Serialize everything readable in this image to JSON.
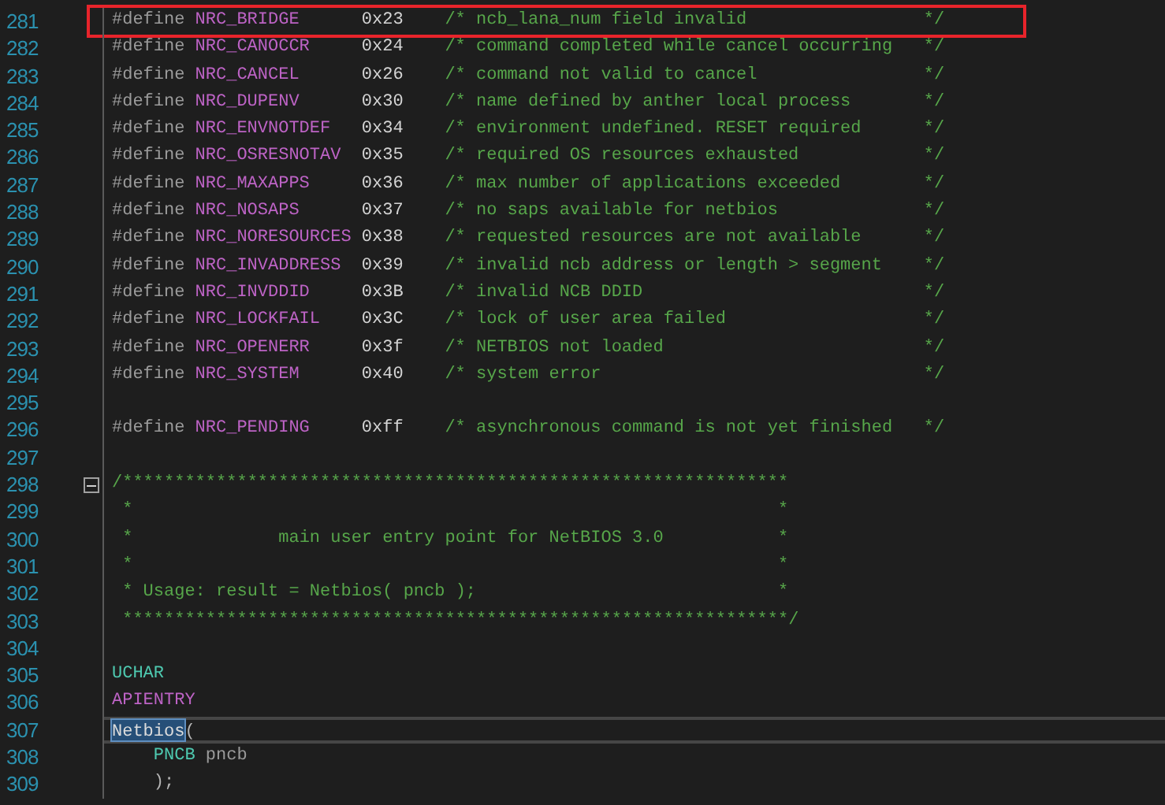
{
  "lines": [
    {
      "number": "281",
      "flagged": true,
      "tokens": [
        {
          "kind": "directive",
          "text": "#define"
        },
        {
          "kind": "macro",
          "text": "NRC_BRIDGE"
        },
        {
          "kind": "value",
          "text": "0x23"
        },
        {
          "kind": "comment",
          "text": "/* ncb_lana_num field invalid"
        },
        {
          "kind": "comment_end",
          "text": "*/"
        }
      ]
    },
    {
      "number": "282",
      "tokens": [
        {
          "kind": "directive",
          "text": "#define"
        },
        {
          "kind": "macro",
          "text": "NRC_CANOCCR"
        },
        {
          "kind": "value",
          "text": "0x24"
        },
        {
          "kind": "comment",
          "text": "/* command completed while cancel occurring"
        },
        {
          "kind": "comment_end",
          "text": "*/"
        }
      ]
    },
    {
      "number": "283",
      "tokens": [
        {
          "kind": "directive",
          "text": "#define"
        },
        {
          "kind": "macro",
          "text": "NRC_CANCEL"
        },
        {
          "kind": "value",
          "text": "0x26"
        },
        {
          "kind": "comment",
          "text": "/* command not valid to cancel"
        },
        {
          "kind": "comment_end",
          "text": "*/"
        }
      ]
    },
    {
      "number": "284",
      "tokens": [
        {
          "kind": "directive",
          "text": "#define"
        },
        {
          "kind": "macro",
          "text": "NRC_DUPENV"
        },
        {
          "kind": "value",
          "text": "0x30"
        },
        {
          "kind": "comment",
          "text": "/* name defined by anther local process"
        },
        {
          "kind": "comment_end",
          "text": "*/"
        }
      ]
    },
    {
      "number": "285",
      "tokens": [
        {
          "kind": "directive",
          "text": "#define"
        },
        {
          "kind": "macro",
          "text": "NRC_ENVNOTDEF"
        },
        {
          "kind": "value",
          "text": "0x34"
        },
        {
          "kind": "comment",
          "text": "/* environment undefined. RESET required"
        },
        {
          "kind": "comment_end",
          "text": "*/"
        }
      ]
    },
    {
      "number": "286",
      "tokens": [
        {
          "kind": "directive",
          "text": "#define"
        },
        {
          "kind": "macro",
          "text": "NRC_OSRESNOTAV"
        },
        {
          "kind": "value",
          "text": "0x35"
        },
        {
          "kind": "comment",
          "text": "/* required OS resources exhausted"
        },
        {
          "kind": "comment_end",
          "text": "*/"
        }
      ]
    },
    {
      "number": "287",
      "tokens": [
        {
          "kind": "directive",
          "text": "#define"
        },
        {
          "kind": "macro",
          "text": "NRC_MAXAPPS"
        },
        {
          "kind": "value",
          "text": "0x36"
        },
        {
          "kind": "comment",
          "text": "/* max number of applications exceeded"
        },
        {
          "kind": "comment_end",
          "text": "*/"
        }
      ]
    },
    {
      "number": "288",
      "tokens": [
        {
          "kind": "directive",
          "text": "#define"
        },
        {
          "kind": "macro",
          "text": "NRC_NOSAPS"
        },
        {
          "kind": "value",
          "text": "0x37"
        },
        {
          "kind": "comment",
          "text": "/* no saps available for netbios"
        },
        {
          "kind": "comment_end",
          "text": "*/"
        }
      ]
    },
    {
      "number": "289",
      "tokens": [
        {
          "kind": "directive",
          "text": "#define"
        },
        {
          "kind": "macro",
          "text": "NRC_NORESOURCES"
        },
        {
          "kind": "value",
          "text": "0x38"
        },
        {
          "kind": "comment",
          "text": "/* requested resources are not available"
        },
        {
          "kind": "comment_end",
          "text": "*/"
        }
      ]
    },
    {
      "number": "290",
      "tokens": [
        {
          "kind": "directive",
          "text": "#define"
        },
        {
          "kind": "macro",
          "text": "NRC_INVADDRESS"
        },
        {
          "kind": "value",
          "text": "0x39"
        },
        {
          "kind": "comment",
          "text": "/* invalid ncb address or length > segment"
        },
        {
          "kind": "comment_end",
          "text": "*/"
        }
      ]
    },
    {
      "number": "291",
      "tokens": [
        {
          "kind": "directive",
          "text": "#define"
        },
        {
          "kind": "macro",
          "text": "NRC_INVDDID"
        },
        {
          "kind": "value",
          "text": "0x3B"
        },
        {
          "kind": "comment",
          "text": "/* invalid NCB DDID"
        },
        {
          "kind": "comment_end",
          "text": "*/"
        }
      ]
    },
    {
      "number": "292",
      "tokens": [
        {
          "kind": "directive",
          "text": "#define"
        },
        {
          "kind": "macro",
          "text": "NRC_LOCKFAIL"
        },
        {
          "kind": "value",
          "text": "0x3C"
        },
        {
          "kind": "comment",
          "text": "/* lock of user area failed"
        },
        {
          "kind": "comment_end",
          "text": "*/"
        }
      ]
    },
    {
      "number": "293",
      "tokens": [
        {
          "kind": "directive",
          "text": "#define"
        },
        {
          "kind": "macro",
          "text": "NRC_OPENERR"
        },
        {
          "kind": "value",
          "text": "0x3f"
        },
        {
          "kind": "comment",
          "text": "/* NETBIOS not loaded"
        },
        {
          "kind": "comment_end",
          "text": "*/"
        }
      ]
    },
    {
      "number": "294",
      "tokens": [
        {
          "kind": "directive",
          "text": "#define"
        },
        {
          "kind": "macro",
          "text": "NRC_SYSTEM"
        },
        {
          "kind": "value",
          "text": "0x40"
        },
        {
          "kind": "comment",
          "text": "/* system error"
        },
        {
          "kind": "comment_end",
          "text": "*/"
        }
      ]
    },
    {
      "number": "295"
    },
    {
      "number": "296",
      "tokens": [
        {
          "kind": "directive",
          "text": "#define"
        },
        {
          "kind": "macro",
          "text": "NRC_PENDING"
        },
        {
          "kind": "value",
          "text": "0xff"
        },
        {
          "kind": "comment",
          "text": "/* asynchronous command is not yet finished"
        },
        {
          "kind": "comment_end",
          "text": "*/"
        }
      ]
    },
    {
      "number": "297"
    },
    {
      "number": "298",
      "fold": {
        "expanded": true
      },
      "tokens": [
        {
          "kind": "block_comment",
          "text": "/****************************************************************"
        }
      ]
    },
    {
      "number": "299",
      "tokens": [
        {
          "kind": "block_comment",
          "text": " *                                                              *"
        }
      ]
    },
    {
      "number": "300",
      "tokens": [
        {
          "kind": "block_comment",
          "text": " *              main user entry point for NetBIOS 3.0           *"
        }
      ]
    },
    {
      "number": "301",
      "tokens": [
        {
          "kind": "block_comment",
          "text": " *                                                              *"
        }
      ]
    },
    {
      "number": "302",
      "tokens": [
        {
          "kind": "block_comment",
          "text": " * Usage: result = Netbios( pncb );                             *"
        }
      ]
    },
    {
      "number": "303",
      "tokens": [
        {
          "kind": "block_comment",
          "text": " ****************************************************************/"
        }
      ]
    },
    {
      "number": "304"
    },
    {
      "number": "305",
      "tokens": [
        {
          "kind": "type",
          "text": "UCHAR"
        }
      ]
    },
    {
      "number": "306",
      "tokens": [
        {
          "kind": "macro_plain",
          "text": "APIENTRY"
        }
      ]
    },
    {
      "number": "307",
      "current": true,
      "tokens": [
        {
          "kind": "function",
          "text": "Netbios",
          "selected": true
        },
        {
          "kind": "punct",
          "text": "("
        }
      ]
    },
    {
      "number": "308",
      "indented": true,
      "tokens": [
        {
          "kind": "type",
          "text": "PNCB"
        },
        {
          "kind": "param",
          "text": "pncb"
        }
      ]
    },
    {
      "number": "309",
      "indented": true,
      "tokens": [
        {
          "kind": "punct",
          "text": ");"
        }
      ]
    }
  ]
}
